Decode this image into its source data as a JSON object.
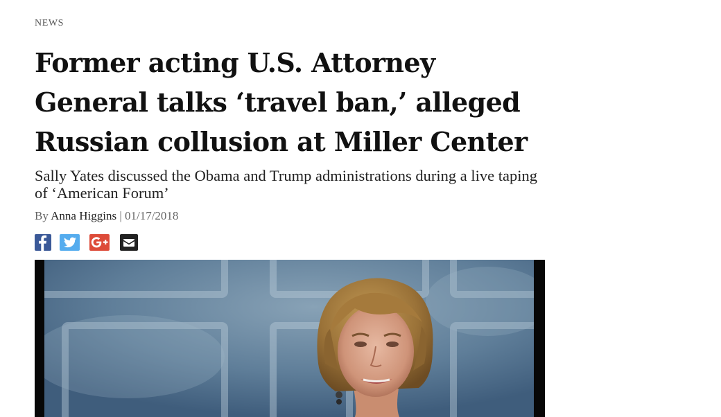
{
  "article": {
    "kicker": "NEWS",
    "headline": "Former acting U.S. Attorney General talks ‘travel ban,’ alleged Russian collusion at Miller Center",
    "subheadline": "Sally Yates discussed the Obama and Trump administrations during a live taping of ‘American Forum’",
    "byline": {
      "prefix": "By",
      "author": "Anna Higgins",
      "separator": "|",
      "date": "01/17/2018"
    }
  },
  "share": [
    {
      "name": "facebook",
      "icon": "facebook-icon",
      "color": "#3b5998"
    },
    {
      "name": "twitter",
      "icon": "twitter-icon",
      "color": "#55acee"
    },
    {
      "name": "google-plus",
      "icon": "google-plus-icon",
      "color": "#dd4b39"
    },
    {
      "name": "email",
      "icon": "envelope-icon",
      "color": "#222222"
    }
  ],
  "hero_image": {
    "icon": "photo-of-speaker",
    "background": "#5d7c98"
  }
}
